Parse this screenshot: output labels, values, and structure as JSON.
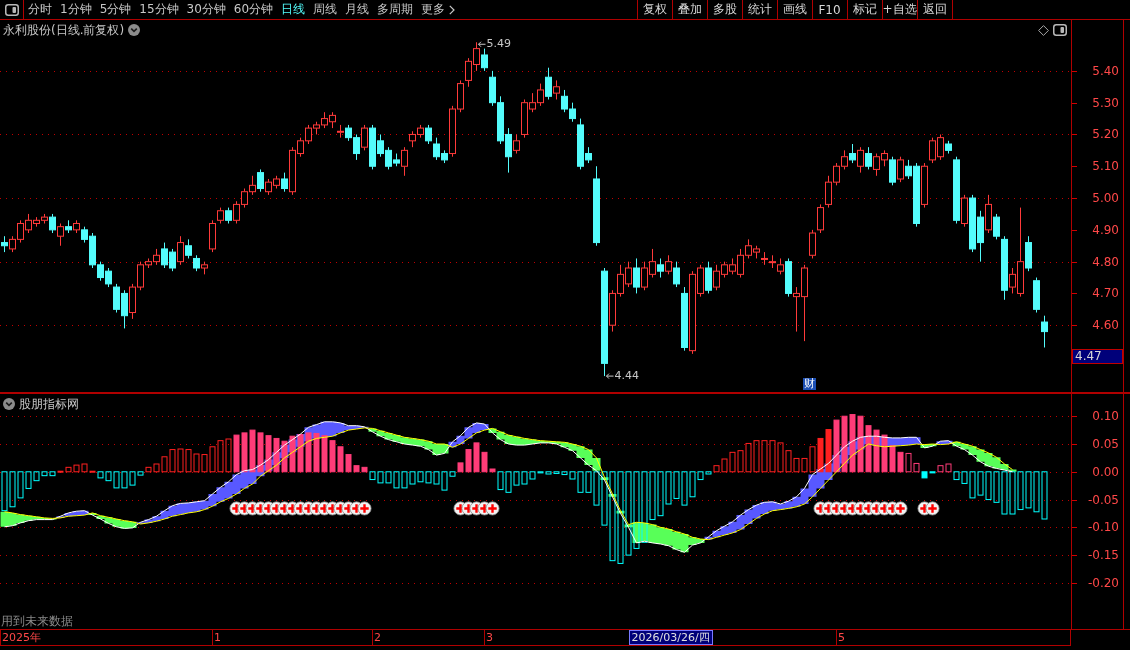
{
  "toolbar": {
    "periods": [
      {
        "label": "分时",
        "selected": false
      },
      {
        "label": "1分钟",
        "selected": false
      },
      {
        "label": "5分钟",
        "selected": false
      },
      {
        "label": "15分钟",
        "selected": false
      },
      {
        "label": "30分钟",
        "selected": false
      },
      {
        "label": "60分钟",
        "selected": false
      },
      {
        "label": "日线",
        "selected": true
      },
      {
        "label": "周线",
        "selected": false
      },
      {
        "label": "月线",
        "selected": false
      },
      {
        "label": "多周期",
        "selected": false
      }
    ],
    "more": "更多",
    "actions": [
      "复权",
      "叠加",
      "多股",
      "统计",
      "画线",
      "F10",
      "标记",
      "+自选",
      "返回"
    ]
  },
  "price_panel": {
    "title": "永利股份(日线.前复权)",
    "cursor_price": "4.47",
    "event_badge": "财",
    "chart_data": [
      {
        "type": "candlestick",
        "ylim": [
          4.39,
          5.56
        ],
        "yticks": [
          {
            "value": 5.4,
            "label": "5.40"
          },
          {
            "value": 5.3,
            "label": "5.30"
          },
          {
            "value": 5.2,
            "label": "5.20"
          },
          {
            "value": 5.1,
            "label": "5.10"
          },
          {
            "value": 5.0,
            "label": "5.00"
          },
          {
            "value": 4.9,
            "label": "4.90"
          },
          {
            "value": 4.8,
            "label": "4.80"
          },
          {
            "value": 4.7,
            "label": "4.70"
          },
          {
            "value": 4.6,
            "label": "4.60"
          }
        ],
        "grid": true,
        "annotations": [
          "5.49",
          "4.44"
        ],
        "ohlc": [
          [
            4.86,
            4.88,
            4.83,
            4.85
          ],
          [
            4.84,
            4.88,
            4.83,
            4.87
          ],
          [
            4.87,
            4.93,
            4.86,
            4.92
          ],
          [
            4.9,
            4.95,
            4.89,
            4.93
          ],
          [
            4.92,
            4.94,
            4.91,
            4.93
          ],
          [
            4.93,
            4.95,
            4.92,
            4.94
          ],
          [
            4.94,
            4.95,
            4.89,
            4.9
          ],
          [
            4.88,
            4.92,
            4.85,
            4.91
          ],
          [
            4.91,
            4.93,
            4.89,
            4.9
          ],
          [
            4.9,
            4.93,
            4.89,
            4.92
          ],
          [
            4.9,
            4.91,
            4.86,
            4.87
          ],
          [
            4.88,
            4.89,
            4.78,
            4.79
          ],
          [
            4.79,
            4.8,
            4.74,
            4.75
          ],
          [
            4.77,
            4.78,
            4.72,
            4.73
          ],
          [
            4.72,
            4.73,
            4.64,
            4.65
          ],
          [
            4.7,
            4.71,
            4.59,
            4.63
          ],
          [
            4.64,
            4.73,
            4.62,
            4.72
          ],
          [
            4.72,
            4.8,
            4.71,
            4.79
          ],
          [
            4.79,
            4.81,
            4.78,
            4.8
          ],
          [
            4.8,
            4.84,
            4.79,
            4.82
          ],
          [
            4.84,
            4.86,
            4.78,
            4.79
          ],
          [
            4.83,
            4.84,
            4.77,
            4.78
          ],
          [
            4.8,
            4.88,
            4.79,
            4.86
          ],
          [
            4.85,
            4.87,
            4.81,
            4.82
          ],
          [
            4.81,
            4.82,
            4.77,
            4.78
          ],
          [
            4.78,
            4.8,
            4.76,
            4.79
          ],
          [
            4.84,
            4.93,
            4.83,
            4.92
          ],
          [
            4.93,
            4.97,
            4.92,
            4.96
          ],
          [
            4.96,
            4.97,
            4.92,
            4.93
          ],
          [
            4.93,
            4.99,
            4.92,
            4.98
          ],
          [
            4.98,
            5.03,
            4.97,
            5.02
          ],
          [
            5.02,
            5.07,
            5.01,
            5.04
          ],
          [
            5.08,
            5.09,
            5.02,
            5.03
          ],
          [
            5.02,
            5.06,
            5.01,
            5.05
          ],
          [
            5.04,
            5.07,
            5.03,
            5.06
          ],
          [
            5.06,
            5.08,
            5.02,
            5.03
          ],
          [
            5.02,
            5.16,
            5.01,
            5.15
          ],
          [
            5.14,
            5.19,
            5.13,
            5.18
          ],
          [
            5.18,
            5.23,
            5.17,
            5.22
          ],
          [
            5.22,
            5.24,
            5.2,
            5.23
          ],
          [
            5.23,
            5.27,
            5.22,
            5.25
          ],
          [
            5.24,
            5.27,
            5.22,
            5.26
          ],
          [
            5.21,
            5.23,
            5.19,
            5.21
          ],
          [
            5.22,
            5.23,
            5.18,
            5.19
          ],
          [
            5.19,
            5.2,
            5.12,
            5.14
          ],
          [
            5.16,
            5.23,
            5.15,
            5.22
          ],
          [
            5.22,
            5.23,
            5.09,
            5.1
          ],
          [
            5.18,
            5.2,
            5.13,
            5.14
          ],
          [
            5.15,
            5.16,
            5.09,
            5.1
          ],
          [
            5.12,
            5.14,
            5.1,
            5.11
          ],
          [
            5.1,
            5.16,
            5.07,
            5.15
          ],
          [
            5.18,
            5.21,
            5.16,
            5.2
          ],
          [
            5.2,
            5.23,
            5.19,
            5.22
          ],
          [
            5.22,
            5.23,
            5.17,
            5.18
          ],
          [
            5.17,
            5.19,
            5.12,
            5.13
          ],
          [
            5.14,
            5.15,
            5.11,
            5.12
          ],
          [
            5.14,
            5.29,
            5.13,
            5.28
          ],
          [
            5.28,
            5.37,
            5.27,
            5.36
          ],
          [
            5.37,
            5.44,
            5.35,
            5.43
          ],
          [
            5.42,
            5.49,
            5.4,
            5.47
          ],
          [
            5.45,
            5.47,
            5.4,
            5.41
          ],
          [
            5.38,
            5.4,
            5.29,
            5.3
          ],
          [
            5.3,
            5.32,
            5.17,
            5.18
          ],
          [
            5.2,
            5.22,
            5.08,
            5.13
          ],
          [
            5.15,
            5.2,
            5.14,
            5.18
          ],
          [
            5.2,
            5.31,
            5.19,
            5.3
          ],
          [
            5.28,
            5.33,
            5.27,
            5.3
          ],
          [
            5.3,
            5.36,
            5.29,
            5.34
          ],
          [
            5.38,
            5.41,
            5.31,
            5.32
          ],
          [
            5.33,
            5.37,
            5.31,
            5.35
          ],
          [
            5.32,
            5.34,
            5.27,
            5.28
          ],
          [
            5.28,
            5.3,
            5.24,
            5.25
          ],
          [
            5.23,
            5.25,
            5.09,
            5.1
          ],
          [
            5.14,
            5.16,
            5.11,
            5.12
          ],
          [
            5.06,
            5.1,
            4.85,
            4.86
          ],
          [
            4.77,
            4.78,
            4.44,
            4.48
          ],
          [
            4.6,
            4.71,
            4.58,
            4.7
          ],
          [
            4.7,
            4.79,
            4.69,
            4.76
          ],
          [
            4.73,
            4.8,
            4.72,
            4.78
          ],
          [
            4.78,
            4.81,
            4.7,
            4.72
          ],
          [
            4.72,
            4.8,
            4.71,
            4.78
          ],
          [
            4.76,
            4.84,
            4.75,
            4.8
          ],
          [
            4.79,
            4.81,
            4.75,
            4.77
          ],
          [
            4.77,
            4.82,
            4.76,
            4.8
          ],
          [
            4.78,
            4.8,
            4.72,
            4.73
          ],
          [
            4.7,
            4.72,
            4.52,
            4.53
          ],
          [
            4.52,
            4.77,
            4.51,
            4.76
          ],
          [
            4.7,
            4.79,
            4.69,
            4.78
          ],
          [
            4.78,
            4.8,
            4.7,
            4.71
          ],
          [
            4.72,
            4.79,
            4.71,
            4.77
          ],
          [
            4.76,
            4.8,
            4.75,
            4.79
          ],
          [
            4.77,
            4.81,
            4.76,
            4.79
          ],
          [
            4.76,
            4.84,
            4.75,
            4.82
          ],
          [
            4.82,
            4.87,
            4.81,
            4.85
          ],
          [
            4.83,
            4.85,
            4.81,
            4.84
          ],
          [
            4.81,
            4.83,
            4.79,
            4.81
          ],
          [
            4.8,
            4.82,
            4.78,
            4.8
          ],
          [
            4.77,
            4.81,
            4.76,
            4.79
          ],
          [
            4.8,
            4.81,
            4.69,
            4.7
          ],
          [
            4.69,
            4.72,
            4.58,
            4.7
          ],
          [
            4.69,
            4.79,
            4.55,
            4.78
          ],
          [
            4.82,
            4.9,
            4.81,
            4.89
          ],
          [
            4.9,
            4.98,
            4.89,
            4.97
          ],
          [
            4.98,
            5.07,
            4.97,
            5.05
          ],
          [
            5.05,
            5.11,
            5.04,
            5.1
          ],
          [
            5.1,
            5.15,
            5.09,
            5.13
          ],
          [
            5.14,
            5.17,
            5.11,
            5.12
          ],
          [
            5.1,
            5.16,
            5.08,
            5.15
          ],
          [
            5.14,
            5.16,
            5.09,
            5.1
          ],
          [
            5.09,
            5.14,
            5.07,
            5.13
          ],
          [
            5.12,
            5.15,
            5.1,
            5.14
          ],
          [
            5.12,
            5.13,
            5.04,
            5.05
          ],
          [
            5.06,
            5.13,
            5.05,
            5.12
          ],
          [
            5.1,
            5.12,
            5.06,
            5.07
          ],
          [
            5.1,
            5.11,
            4.91,
            4.92
          ],
          [
            4.98,
            5.11,
            4.97,
            5.1
          ],
          [
            5.12,
            5.19,
            5.11,
            5.18
          ],
          [
            5.13,
            5.2,
            5.12,
            5.19
          ],
          [
            5.17,
            5.18,
            5.14,
            5.15
          ],
          [
            5.12,
            5.13,
            4.92,
            4.93
          ],
          [
            4.92,
            5.01,
            4.91,
            5.0
          ],
          [
            5.0,
            5.01,
            4.83,
            4.84
          ],
          [
            4.94,
            4.96,
            4.8,
            4.86
          ],
          [
            4.9,
            5.01,
            4.89,
            4.98
          ],
          [
            4.94,
            4.95,
            4.87,
            4.88
          ],
          [
            4.87,
            4.88,
            4.68,
            4.71
          ],
          [
            4.72,
            4.78,
            4.7,
            4.76
          ],
          [
            4.7,
            4.97,
            4.69,
            4.8
          ],
          [
            4.86,
            4.88,
            4.77,
            4.78
          ],
          [
            4.74,
            4.75,
            4.64,
            4.65
          ],
          [
            4.61,
            4.63,
            4.53,
            4.58
          ]
        ]
      }
    ]
  },
  "indicator_panel": {
    "title": "股朋指标网",
    "note": "用到未来数据",
    "chart_data": [
      {
        "type": "bar",
        "ylim": [
          -0.283,
          0.14
        ],
        "yticks": [
          {
            "value": 0.1,
            "label": "0.10"
          },
          {
            "value": 0.05,
            "label": "0.05"
          },
          {
            "value": 0,
            "label": "0.00"
          },
          {
            "value": -0.05,
            "label": "-0.05"
          },
          {
            "value": -0.1,
            "label": "-0.10"
          },
          {
            "value": -0.15,
            "label": "-0.15"
          },
          {
            "value": -0.2,
            "label": "-0.20"
          }
        ],
        "grid": true,
        "series": [
          {
            "type": "bar",
            "color": "#00ffff",
            "values": [
              -0.07,
              -0.063,
              -0.047,
              -0.03,
              -0.016,
              -0.007,
              -0.007,
              null,
              null,
              null,
              null,
              null,
              -0.011,
              -0.016,
              -0.029,
              -0.029,
              -0.024,
              -0.006,
              null,
              null,
              null,
              null,
              null,
              null,
              null,
              null,
              null,
              null,
              null,
              null,
              null,
              null,
              null,
              null,
              null,
              null,
              null,
              null,
              null,
              null,
              null,
              null,
              null,
              null,
              null,
              null,
              -0.014,
              -0.02,
              -0.02,
              -0.029,
              -0.029,
              -0.022,
              -0.018,
              -0.02,
              -0.022,
              -0.033,
              -0.008,
              null,
              null,
              null,
              null,
              null,
              -0.032,
              -0.037,
              -0.024,
              -0.022,
              -0.013,
              -0.002,
              -0.004,
              -0.003,
              -0.005,
              -0.013,
              -0.037,
              -0.037,
              -0.06,
              -0.096,
              -0.16,
              -0.165,
              -0.15,
              -0.138,
              -0.127,
              -0.086,
              -0.079,
              -0.058,
              -0.048,
              -0.06,
              -0.045,
              -0.014,
              -0.004,
              null,
              null,
              null,
              null,
              null,
              null,
              null,
              null,
              null,
              null,
              null,
              null,
              null,
              null,
              null,
              null,
              null,
              null,
              null,
              null,
              null,
              null,
              null,
              null,
              null,
              null,
              -0.011,
              -0.002,
              null,
              null,
              -0.014,
              -0.021,
              -0.047,
              -0.042,
              -0.05,
              -0.055,
              -0.076,
              -0.076,
              -0.068,
              -0.065,
              -0.072,
              -0.085
            ]
          },
          {
            "type": "bar",
            "color": "#ff2020",
            "values": [
              null,
              null,
              null,
              null,
              null,
              null,
              null,
              0.001,
              0.008,
              0.012,
              0.014,
              0.001,
              null,
              null,
              null,
              null,
              null,
              null,
              0.008,
              0.014,
              0.027,
              0.04,
              0.041,
              0.04,
              0.032,
              0.031,
              0.045,
              0.056,
              0.059,
              null,
              null,
              null,
              null,
              null,
              null,
              null,
              null,
              null,
              null,
              null,
              null,
              null,
              null,
              null,
              null,
              null,
              null,
              null,
              null,
              null,
              null,
              null,
              null,
              null,
              null,
              null,
              null,
              null,
              null,
              null,
              null,
              null,
              null,
              null,
              null,
              null,
              null,
              null,
              null,
              null,
              null,
              null,
              null,
              null,
              null,
              null,
              null,
              null,
              null,
              null,
              null,
              null,
              null,
              null,
              null,
              null,
              null,
              null,
              null,
              0.011,
              0.023,
              0.035,
              0.038,
              0.051,
              0.056,
              0.056,
              0.056,
              0.052,
              0.038,
              0.024,
              0.024,
              0.045,
              0.06,
              0.076,
              null,
              null,
              null,
              null,
              null,
              null,
              null,
              null,
              null,
              null,
              null,
              null,
              null,
              null,
              null,
              null,
              null,
              null,
              null,
              null,
              null,
              null,
              null,
              null,
              null,
              null,
              null
            ]
          },
          {
            "type": "bar",
            "color": "#ff3c78",
            "values": [
              null,
              null,
              null,
              null,
              null,
              null,
              null,
              null,
              null,
              null,
              null,
              null,
              null,
              null,
              null,
              null,
              null,
              null,
              null,
              null,
              null,
              null,
              null,
              null,
              null,
              null,
              null,
              null,
              null,
              0.066,
              0.07,
              0.075,
              0.07,
              0.065,
              0.06,
              0.055,
              0.064,
              0.067,
              0.07,
              0.069,
              0.065,
              0.056,
              0.045,
              0.031,
              0.011,
              0.008,
              null,
              null,
              null,
              null,
              null,
              null,
              null,
              null,
              null,
              null,
              null,
              0.016,
              0.04,
              0.052,
              0.035,
              0.005,
              null,
              null,
              null,
              null,
              null,
              null,
              null,
              null,
              null,
              null,
              null,
              null,
              null,
              null,
              null,
              null,
              null,
              null,
              null,
              null,
              null,
              null,
              null,
              null,
              null,
              null,
              null,
              null,
              null,
              null,
              null,
              null,
              null,
              null,
              null,
              null,
              null,
              null,
              null,
              null,
              null,
              null,
              0.093,
              0.1,
              0.103,
              0.1,
              0.083,
              0.075,
              0.066,
              0.047,
              0.035,
              0.033,
              0.015,
              null,
              null,
              0.011,
              0.014,
              null,
              null,
              null,
              null,
              null,
              null,
              null,
              null,
              null,
              null,
              null,
              null
            ]
          },
          {
            "type": "line",
            "color": "#ffffff",
            "values": [
              -0.099,
              -0.097,
              -0.092,
              -0.088,
              -0.086,
              -0.086,
              -0.086,
              -0.08,
              -0.074,
              -0.071,
              -0.07,
              -0.078,
              -0.085,
              -0.093,
              -0.099,
              -0.102,
              -0.101,
              -0.091,
              -0.086,
              -0.08,
              -0.07,
              -0.061,
              -0.057,
              -0.056,
              -0.054,
              -0.052,
              -0.04,
              -0.028,
              -0.018,
              -0.005,
              0.002,
              0.004,
              0.012,
              0.022,
              0.035,
              0.048,
              0.058,
              0.068,
              0.08,
              0.085,
              0.09,
              0.09,
              0.088,
              0.083,
              0.083,
              0.081,
              0.072,
              0.064,
              0.058,
              0.054,
              0.05,
              0.048,
              0.046,
              0.04,
              0.03,
              0.033,
              0.054,
              0.065,
              0.08,
              0.088,
              0.086,
              0.07,
              0.058,
              0.05,
              0.048,
              0.048,
              0.05,
              0.052,
              0.052,
              0.05,
              0.044,
              0.038,
              0.025,
              0.012,
              0.002,
              -0.015,
              -0.045,
              -0.075,
              -0.1,
              -0.128,
              -0.125,
              -0.128,
              -0.13,
              -0.133,
              -0.14,
              -0.145,
              -0.132,
              -0.128,
              -0.117,
              -0.106,
              -0.098,
              -0.09,
              -0.078,
              -0.068,
              -0.06,
              -0.055,
              -0.054,
              -0.058,
              -0.053,
              -0.045,
              -0.03,
              -0.005,
              0.005,
              0.015,
              0.03,
              0.045,
              0.055,
              0.062,
              0.064,
              0.064,
              0.062,
              0.061,
              0.061,
              0.062,
              0.062,
              0.043,
              0.046,
              0.055,
              0.056,
              0.046,
              0.04,
              0.03,
              0.018,
              0.01,
              0.006,
              0.003,
              0,
              null,
              null,
              null,
              null
            ]
          },
          {
            "type": "line",
            "color": "#ffff00",
            "values": [
              -0.072,
              -0.074,
              -0.077,
              -0.079,
              -0.081,
              -0.083,
              -0.084,
              -0.083,
              -0.08,
              -0.079,
              -0.078,
              -0.074,
              -0.079,
              -0.082,
              -0.085,
              -0.088,
              -0.09,
              -0.094,
              -0.092,
              -0.089,
              -0.085,
              -0.08,
              -0.077,
              -0.074,
              -0.072,
              -0.068,
              -0.062,
              -0.054,
              -0.048,
              -0.04,
              -0.03,
              -0.022,
              -0.008,
              0.002,
              0.012,
              0.025,
              0.035,
              0.045,
              0.055,
              0.06,
              0.062,
              0.064,
              0.07,
              0.075,
              0.077,
              0.079,
              0.078,
              0.074,
              0.07,
              0.066,
              0.062,
              0.06,
              0.058,
              0.055,
              0.05,
              0.05,
              0.044,
              0.05,
              0.06,
              0.07,
              0.075,
              0.078,
              0.072,
              0.066,
              0.063,
              0.06,
              0.058,
              0.056,
              0.055,
              0.054,
              0.053,
              0.05,
              0.046,
              0.04,
              0.025,
              -0.01,
              -0.04,
              -0.07,
              -0.095,
              -0.091,
              -0.092,
              -0.095,
              -0.1,
              -0.103,
              -0.108,
              -0.112,
              -0.118,
              -0.121,
              -0.122,
              -0.118,
              -0.114,
              -0.11,
              -0.104,
              -0.094,
              -0.084,
              -0.076,
              -0.07,
              -0.068,
              -0.066,
              -0.063,
              -0.058,
              -0.045,
              -0.03,
              -0.015,
              0,
              0.015,
              0.03,
              0.04,
              0.05,
              0.047,
              0.045,
              0.046,
              0.047,
              0.048,
              0.05,
              0.049,
              0.05,
              0.049,
              0.05,
              0.054,
              0.05,
              0.046,
              0.04,
              0.034,
              0.026,
              0.014,
              0.004,
              null,
              null,
              null,
              null
            ]
          },
          {
            "type": "scatter",
            "marker": "plus-circle",
            "values": [
              null,
              null,
              null,
              null,
              null,
              null,
              null,
              null,
              null,
              null,
              null,
              null,
              null,
              null,
              null,
              null,
              null,
              null,
              null,
              null,
              null,
              null,
              null,
              null,
              null,
              null,
              null,
              null,
              null,
              -0.066,
              -0.066,
              -0.066,
              -0.066,
              -0.066,
              -0.066,
              -0.066,
              -0.066,
              -0.066,
              -0.066,
              -0.066,
              -0.066,
              -0.066,
              -0.066,
              -0.066,
              -0.066,
              -0.066,
              null,
              null,
              null,
              null,
              null,
              null,
              null,
              null,
              null,
              null,
              null,
              -0.066,
              -0.066,
              -0.066,
              -0.066,
              -0.066,
              null,
              null,
              null,
              null,
              null,
              null,
              null,
              null,
              null,
              null,
              null,
              null,
              null,
              null,
              null,
              null,
              null,
              null,
              null,
              null,
              null,
              null,
              null,
              null,
              null,
              null,
              null,
              null,
              null,
              null,
              null,
              null,
              null,
              null,
              null,
              null,
              null,
              null,
              null,
              null,
              -0.066,
              -0.066,
              -0.066,
              -0.066,
              -0.066,
              -0.066,
              -0.066,
              -0.066,
              -0.066,
              -0.066,
              -0.066,
              null,
              null,
              -0.066,
              -0.066,
              null,
              null,
              null,
              null,
              null,
              null,
              null,
              null,
              null,
              null,
              null,
              null
            ]
          }
        ]
      }
    ]
  },
  "time_axis": {
    "labels": [
      "2025年",
      "1",
      "2",
      "3",
      "5"
    ],
    "cursor_date": "2026/03/26/四"
  }
}
